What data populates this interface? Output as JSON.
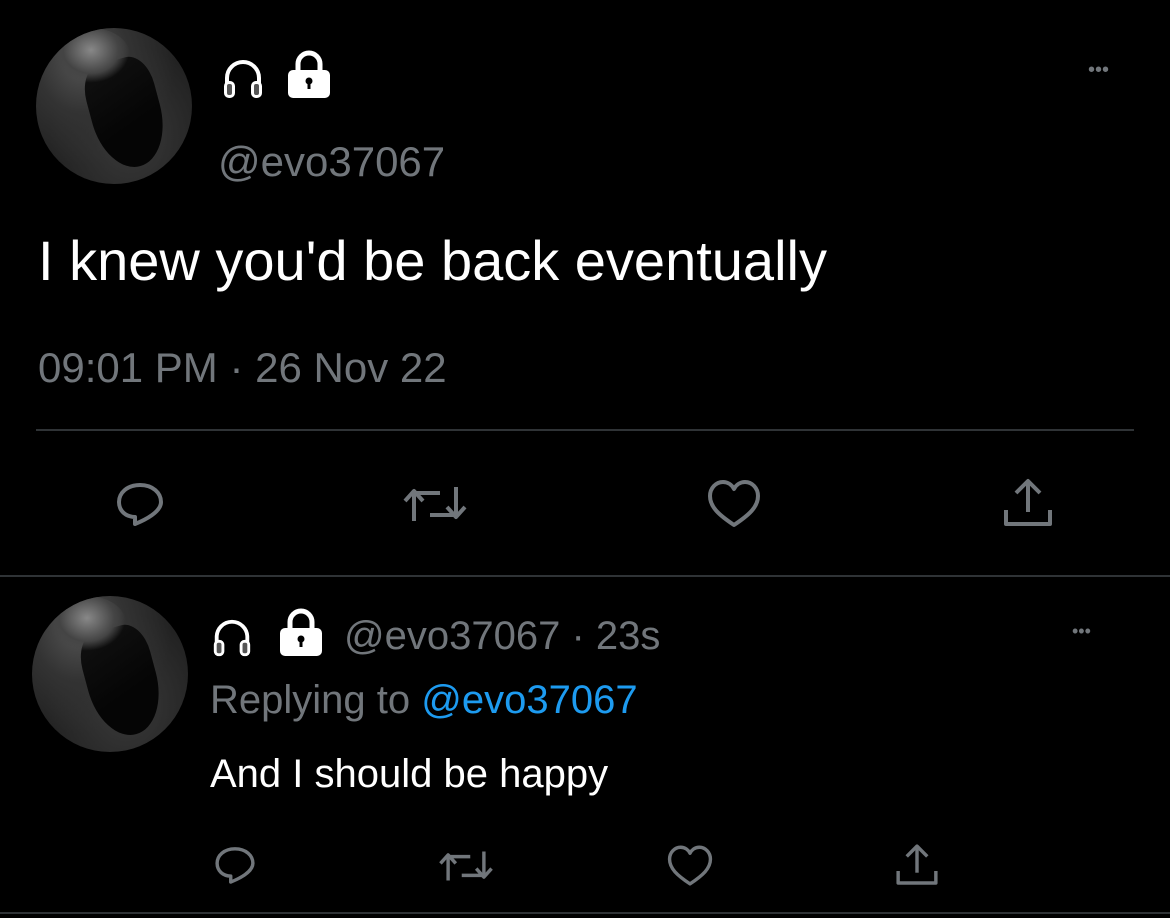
{
  "main_tweet": {
    "handle": "@evo37067",
    "text": "I knew you'd be back eventually",
    "time": "09:01 PM",
    "separator": "·",
    "date": "26 Nov 22",
    "more_label": "•••"
  },
  "reply": {
    "handle": "@evo37067",
    "separator": "·",
    "time_ago": "23s",
    "replying_prefix": "Replying to",
    "replying_handle": "@evo37067",
    "text": "And I should be happy",
    "more_label": "•••"
  },
  "icons": {
    "headphones": "headphones-icon",
    "lock": "lock-icon",
    "reply": "reply-icon",
    "retweet": "retweet-icon",
    "like": "heart-icon",
    "share": "share-icon"
  },
  "colors": {
    "background": "#000000",
    "text": "#e7e9ea",
    "muted": "#71767b",
    "accent": "#1d9bf0",
    "divider": "#2f3336"
  }
}
